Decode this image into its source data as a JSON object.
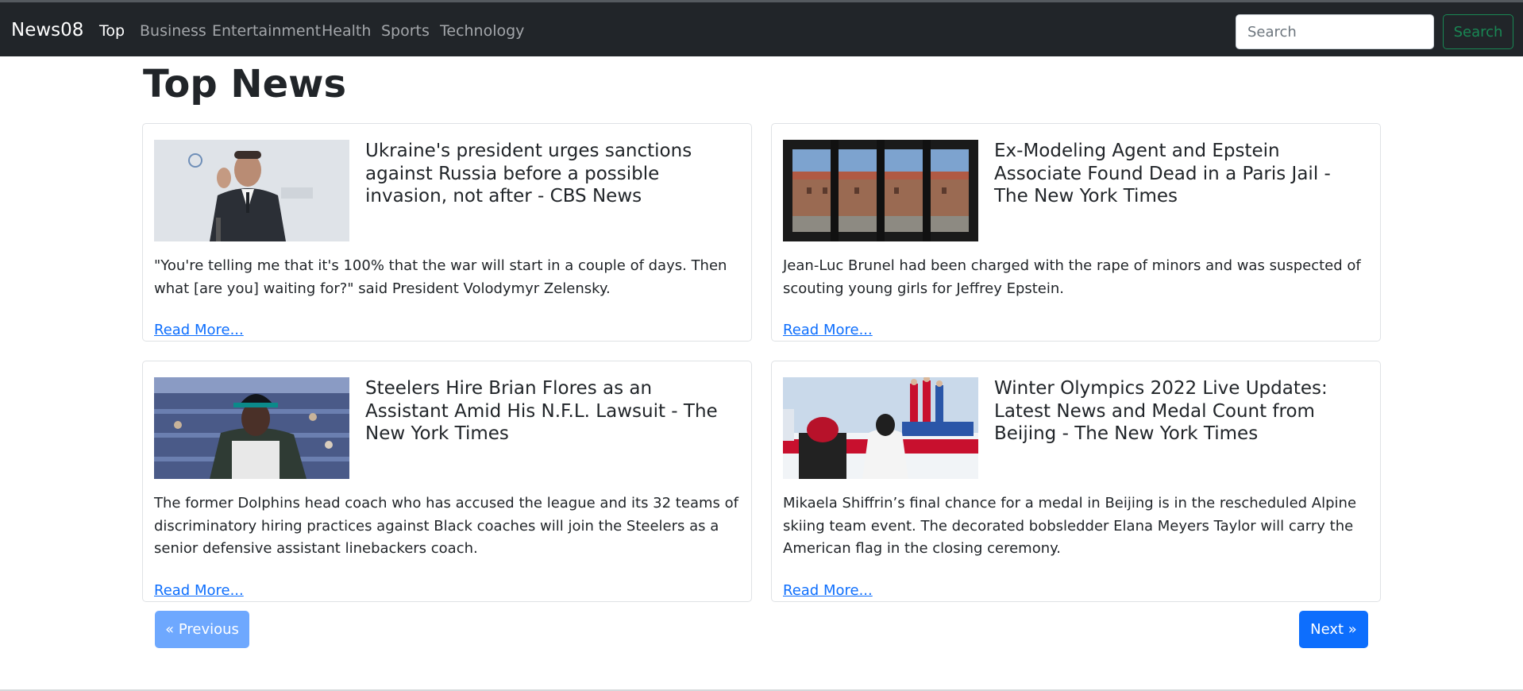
{
  "navbar": {
    "brand": "News08",
    "items": [
      {
        "label": "Top",
        "active": true
      },
      {
        "label": "Business",
        "active": false
      },
      {
        "label": "Entertainment",
        "active": false
      },
      {
        "label": "Health",
        "active": false
      },
      {
        "label": "Sports",
        "active": false
      },
      {
        "label": "Technology",
        "active": false
      }
    ],
    "search_placeholder": "Search",
    "search_button": "Search"
  },
  "page": {
    "title": "Top News"
  },
  "articles": [
    {
      "title": "Ukraine's president urges sanctions against Russia before a possible invasion, not after - CBS News",
      "description": "\"You're telling me that it's 100% that the war will start in a couple of days. Then what [are you] waiting for?\" said President Volodymyr Zelensky.",
      "read_more": "Read More..."
    },
    {
      "title": "Ex-Modeling Agent and Epstein Associate Found Dead in a Paris Jail - The New York Times",
      "description": "Jean-Luc Brunel had been charged with the rape of minors and was suspected of scouting young girls for Jeffrey Epstein.",
      "read_more": "Read More..."
    },
    {
      "title": "Steelers Hire Brian Flores as an Assistant Amid His N.F.L. Lawsuit - The New York Times",
      "description": "The former Dolphins head coach who has accused the league and its 32 teams of discriminatory hiring practices against Black coaches will join the Steelers as a senior defensive assistant linebackers coach.",
      "read_more": "Read More..."
    },
    {
      "title": "Winter Olympics 2022 Live Updates: Latest News and Medal Count from Beijing - The New York Times",
      "description": "Mikaela Shiffrin’s final chance for a medal in Beijing is in the rescheduled Alpine skiing team event. The decorated bobsledder Elana Meyers Taylor will carry the American flag in the closing ceremony.",
      "read_more": "Read More..."
    }
  ],
  "pagination": {
    "previous": "« Previous",
    "next": "Next »"
  },
  "colors": {
    "navbar_bg": "#212529",
    "link": "#0d6efd",
    "search_button": "#198754",
    "previous_button_disabled": "#6ea8fe",
    "next_button": "#0d6efd"
  }
}
